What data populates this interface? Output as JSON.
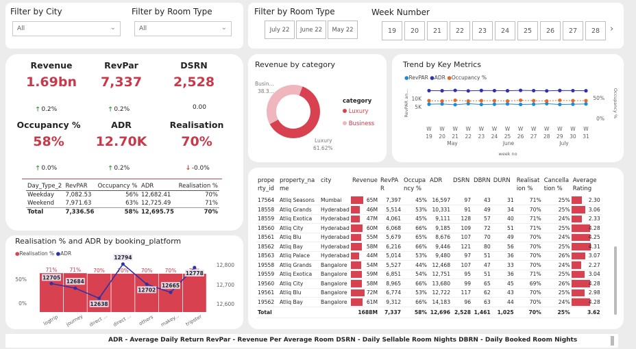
{
  "filters": {
    "city_label": "Filter by City",
    "city_value": "All",
    "room_label": "Filter by Room Type",
    "room_value": "All"
  },
  "slicers": {
    "room_label": "Filter by Room Type",
    "months": [
      "July 22",
      "June 22",
      "May 22"
    ],
    "week_label": "Week Number",
    "weeks": [
      "19",
      "20",
      "21",
      "22",
      "23",
      "24",
      "25",
      "26",
      "27",
      "28"
    ]
  },
  "kpis": {
    "revenue": {
      "label": "Revenue",
      "value": "1.69bn",
      "change": "0.2%"
    },
    "revpar": {
      "label": "RevPar",
      "value": "7,337",
      "change": "0.2%"
    },
    "dsrn": {
      "label": "DSRN",
      "value": "2,528",
      "change": "0.00"
    },
    "occupancy": {
      "label": "Occupancy %",
      "value": "58%",
      "change": "0.0%"
    },
    "adr": {
      "label": "ADR",
      "value": "12.70K",
      "change": "0.2%"
    },
    "realisation": {
      "label": "Realisation",
      "value": "70%",
      "change": "-0.0%"
    }
  },
  "daytype_table": {
    "headers": [
      "Day_Type_2",
      "RevPAR",
      "Occupancy %",
      "ADR",
      "Realisation %"
    ],
    "rows": [
      [
        "Weekday",
        "7,082.53",
        "56%",
        "12,682.41",
        "70%"
      ],
      [
        "Weekend",
        "7,971.63",
        "63%",
        "12,725.49",
        "71%"
      ],
      [
        "Total",
        "7,336.56",
        "58%",
        "12,695.75",
        "70%"
      ]
    ]
  },
  "donut": {
    "title": "Revenue by category",
    "legend_title": "category",
    "lbl_business": "Busin...",
    "lbl_business_val": "38.3...",
    "lbl_luxury": "Luxury",
    "lbl_luxury_val": "61.62%"
  },
  "trend": {
    "title": "Trend by Key Metrics",
    "legend": [
      "RevPAR",
      "ADR",
      "Occupancy %"
    ],
    "y_left_title": "RevPAR an...",
    "y_right_title": "Occupancy %",
    "y_left_ticks": [
      "10K",
      "5K"
    ],
    "y_right_ticks": [
      "50%",
      "0%"
    ],
    "x_w": "W",
    "x_months": [
      "May",
      "June",
      "July"
    ],
    "x_title": "week no"
  },
  "platform": {
    "title": "Realisation % and ADR by booking_platform",
    "legend": [
      "Realisation %",
      "ADR"
    ],
    "y_left_ticks": [
      "50%",
      "0%"
    ],
    "y_right_ticks": [
      "12,800",
      "12,700",
      "12,600"
    ]
  },
  "matrix": {
    "headers": [
      "prope rty_id",
      "property_na me",
      "city",
      "Revenue",
      "RevPA R",
      "Occupa ncy %",
      "ADR",
      "DSRN",
      "DBRN",
      "DURN",
      "Realisat ion %",
      "Cancella tion %",
      "Average Rating"
    ],
    "rows": [
      [
        "17564",
        "Atliq Seasons",
        "Mumbai",
        "65M",
        "7,397",
        "45%",
        "16,597",
        "97",
        "43",
        "31",
        "71%",
        "25%",
        "2.30"
      ],
      [
        "18558",
        "Atliq Grands",
        "Hyderabad",
        "46M",
        "5,514",
        "53%",
        "10,331",
        "91",
        "49",
        "34",
        "70%",
        "25%",
        "3.06"
      ],
      [
        "18559",
        "Atliq Exotica",
        "Hyderabad",
        "47M",
        "4,061",
        "45%",
        "9,111",
        "128",
        "57",
        "40",
        "71%",
        "24%",
        "2.33"
      ],
      [
        "18560",
        "Atliq City",
        "Hyderabad",
        "60M",
        "6,068",
        "66%",
        "9,185",
        "109",
        "72",
        "51",
        "71%",
        "25%",
        "4.28"
      ],
      [
        "18561",
        "Atliq Blu",
        "Hyderabad",
        "55M",
        "5,679",
        "65%",
        "8,676",
        "107",
        "70",
        "49",
        "70%",
        "24%",
        "4.25"
      ],
      [
        "18562",
        "Atliq Bay",
        "Hyderabad",
        "58M",
        "6,216",
        "66%",
        "9,446",
        "121",
        "80",
        "56",
        "70%",
        "25%",
        "4.31"
      ],
      [
        "18563",
        "Atliq Palace",
        "Hyderabad",
        "44M",
        "5,014",
        "53%",
        "9,480",
        "97",
        "51",
        "36",
        "70%",
        "26%",
        "3.07"
      ],
      [
        "19558",
        "Atliq Grands",
        "Bangalore",
        "54M",
        "5,527",
        "44%",
        "12,468",
        "107",
        "47",
        "33",
        "70%",
        "24%",
        "2.27"
      ],
      [
        "19559",
        "Atliq Exotica",
        "Bangalore",
        "59M",
        "6,851",
        "54%",
        "12,751",
        "95",
        "51",
        "36",
        "71%",
        "25%",
        "3.04"
      ],
      [
        "19560",
        "Atliq City",
        "Bangalore",
        "58M",
        "8,965",
        "66%",
        "13,680",
        "99",
        "65",
        "45",
        "69%",
        "26%",
        "4.28"
      ],
      [
        "19561",
        "Atliq Blu",
        "Bangalore",
        "72M",
        "6,774",
        "53%",
        "12,722",
        "117",
        "62",
        "43",
        "70%",
        "25%",
        "2.98"
      ],
      [
        "19562",
        "Atliq Bay",
        "Bangalore",
        "61M",
        "9,312",
        "66%",
        "14,183",
        "96",
        "63",
        "44",
        "70%",
        "24%",
        "4.28"
      ]
    ],
    "total": [
      "Total",
      "",
      "",
      "1688M",
      "7,337",
      "58%",
      "12,696",
      "2,528",
      "1,461",
      "1,025",
      "70%",
      "25%",
      "3.62"
    ]
  },
  "footer": "ADR - Average Daily Return RevPar - Revenue Per Average Room DSRN - Daily Sellable Room Nights DBRN - Daily Booked Room Nights",
  "colors": {
    "accent": "#c8394a",
    "bar": "#d8414f",
    "light": "#f0b6bd",
    "blue": "#2d32a8",
    "orange": "#e06a2c",
    "cyan": "#1b8bd6"
  },
  "chart_data": [
    {
      "type": "pie",
      "title": "Revenue by category",
      "categories": [
        "Luxury",
        "Business"
      ],
      "values": [
        61.62,
        38.38
      ],
      "legend": "right"
    },
    {
      "type": "line",
      "title": "Trend by Key Metrics",
      "x": [
        "19",
        "20",
        "21",
        "22",
        "23",
        "24",
        "25",
        "26",
        "27",
        "28",
        "29",
        "30",
        "31"
      ],
      "xlabel": "week no",
      "ylabel": "RevPAR an...",
      "series": [
        {
          "name": "RevPAR",
          "values": [
            7300,
            7400,
            7100,
            7500,
            7200,
            7300,
            7400,
            7200,
            7300,
            7500,
            7200,
            7300,
            7400
          ]
        },
        {
          "name": "ADR",
          "values": [
            12700,
            12650,
            12800,
            12600,
            12750,
            12700,
            12650,
            12800,
            12700,
            12600,
            12750,
            12700,
            12650
          ]
        },
        {
          "name": "Occupancy %",
          "values": [
            58,
            57,
            59,
            57,
            58,
            58,
            57,
            59,
            58,
            57,
            59,
            58,
            58
          ]
        }
      ]
    },
    {
      "type": "bar",
      "title": "Realisation % and ADR by booking_platform",
      "categories": [
        "logtrip",
        "journey",
        "direct ...",
        "direct ...",
        "others",
        "makey...",
        "tripster"
      ],
      "series": [
        {
          "name": "Realisation %",
          "values": [
            71,
            71,
            70,
            70,
            70,
            70,
            70
          ]
        },
        {
          "name": "ADR",
          "values": [
            12705,
            12684,
            12638,
            12794,
            12702,
            12665,
            12778
          ]
        }
      ],
      "y_right_range": [
        12600,
        12800
      ],
      "legend": "top-left"
    }
  ]
}
